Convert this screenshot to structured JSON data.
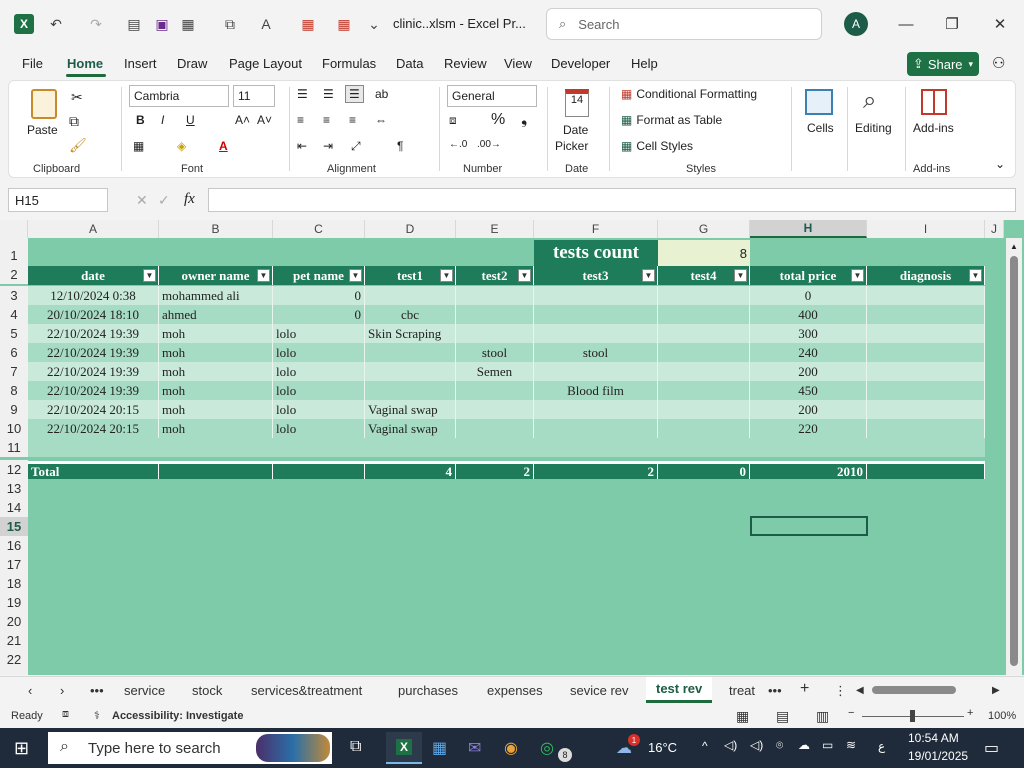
{
  "window": {
    "title": "clinic..xlsm  -  Excel Pr...",
    "search_placeholder": "Search",
    "avatar_initial": "A"
  },
  "menu": [
    "File",
    "Home",
    "Insert",
    "Draw",
    "Page Layout",
    "Formulas",
    "Data",
    "Review",
    "View",
    "Developer",
    "Help"
  ],
  "share_label": "Share",
  "ribbon": {
    "clipboard": {
      "paste": "Paste",
      "group": "Clipboard"
    },
    "font": {
      "name": "Cambria",
      "size": "11",
      "group": "Font"
    },
    "alignment": {
      "group": "Alignment"
    },
    "number": {
      "format": "General",
      "group": "Number"
    },
    "date": {
      "label1": "Date",
      "label2": "Picker",
      "group": "Date"
    },
    "styles": {
      "cf": "Conditional Formatting",
      "fat": "Format as Table",
      "cs": "Cell Styles",
      "group": "Styles"
    },
    "cells": "Cells",
    "editing": "Editing",
    "addins": {
      "label": "Add-ins",
      "group": "Add-ins"
    }
  },
  "formula_bar": {
    "name_box": "H15",
    "fx": "fx",
    "value": ""
  },
  "columns": [
    "A",
    "B",
    "C",
    "D",
    "E",
    "F",
    "G",
    "H",
    "I",
    "J"
  ],
  "rows": [
    "1",
    "2",
    "3",
    "4",
    "5",
    "6",
    "7",
    "8",
    "9",
    "10",
    "11",
    "12",
    "13",
    "14",
    "15",
    "16",
    "17",
    "18",
    "19",
    "20",
    "21",
    "22"
  ],
  "sheet": {
    "tests_count_label": "tests count",
    "tests_count_value": "8",
    "headers": [
      "date",
      "owner name",
      "pet name",
      "test1",
      "test2",
      "test3",
      "test4",
      "total price",
      "diagnosis"
    ],
    "data": [
      [
        "12/10/2024 0:38",
        "mohammed ali",
        "0",
        "",
        "",
        "",
        "",
        "0",
        ""
      ],
      [
        "20/10/2024 18:10",
        "ahmed",
        "0",
        "cbc",
        "",
        "",
        "",
        "400",
        ""
      ],
      [
        "22/10/2024 19:39",
        "moh",
        "lolo",
        "Skin Scraping",
        "",
        "",
        "",
        "300",
        ""
      ],
      [
        "22/10/2024 19:39",
        "moh",
        "lolo",
        "",
        "stool",
        "stool",
        "",
        "240",
        ""
      ],
      [
        "22/10/2024 19:39",
        "moh",
        "lolo",
        "",
        "Semen",
        "",
        "",
        "200",
        ""
      ],
      [
        "22/10/2024 19:39",
        "moh",
        "lolo",
        "",
        "",
        "Blood film",
        "",
        "450",
        ""
      ],
      [
        "22/10/2024 20:15",
        "moh",
        "lolo",
        "Vaginal swap",
        "",
        "",
        "",
        "200",
        ""
      ],
      [
        "22/10/2024 20:15",
        "moh",
        "lolo",
        "Vaginal swap",
        "",
        "",
        "",
        "220",
        ""
      ]
    ],
    "total": [
      "Total",
      "",
      "",
      "4",
      "2",
      "2",
      "0",
      "2010",
      ""
    ]
  },
  "sheet_tabs": [
    "service",
    "stock",
    "services&treatment",
    "purchases",
    "expenses",
    "sevice rev",
    "test rev",
    "treat"
  ],
  "active_sheet": "test rev",
  "status": {
    "ready": "Ready",
    "accessibility": "Accessibility: Investigate",
    "zoom": "100%"
  },
  "taskbar": {
    "search": "Type here to search",
    "temp": "16°C",
    "lang": "ع",
    "time": "10:54 AM",
    "date": "19/01/2025",
    "badge": "8",
    "notif": "1"
  }
}
